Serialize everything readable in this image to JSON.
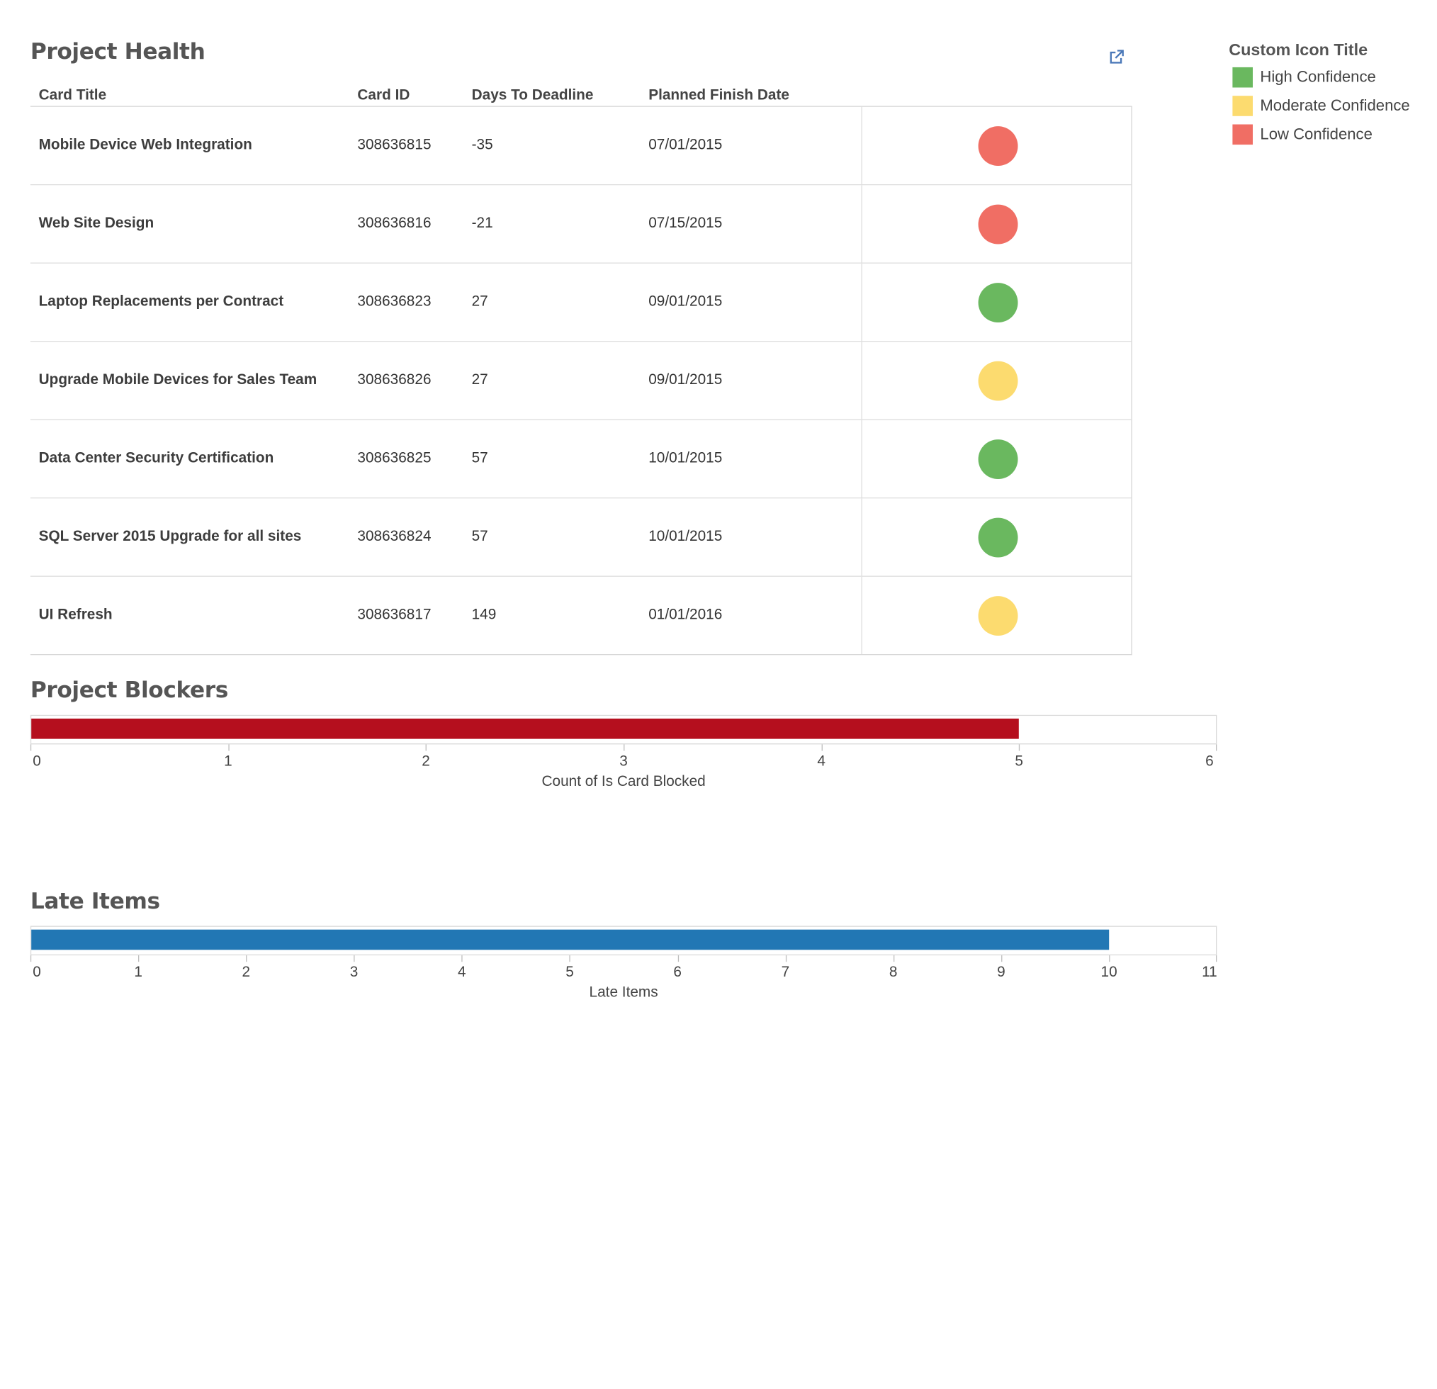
{
  "project_health": {
    "title": "Project Health",
    "columns": [
      "Card Title",
      "Card ID",
      "Days To Deadline",
      "Planned Finish Date"
    ],
    "rows": [
      {
        "title": "Mobile Device Web Integration",
        "card_id": "308636815",
        "days": "-35",
        "date": "07/01/2015",
        "confidence": "low"
      },
      {
        "title": "Web Site Design",
        "card_id": "308636816",
        "days": "-21",
        "date": "07/15/2015",
        "confidence": "low"
      },
      {
        "title": "Laptop Replacements per Contract",
        "card_id": "308636823",
        "days": "27",
        "date": "09/01/2015",
        "confidence": "high"
      },
      {
        "title": "Upgrade Mobile Devices for Sales Team",
        "card_id": "308636826",
        "days": "27",
        "date": "09/01/2015",
        "confidence": "moderate"
      },
      {
        "title": "Data Center Security Certification",
        "card_id": "308636825",
        "days": "57",
        "date": "10/01/2015",
        "confidence": "high"
      },
      {
        "title": "SQL Server 2015 Upgrade for all sites",
        "card_id": "308636824",
        "days": "57",
        "date": "10/01/2015",
        "confidence": "high"
      },
      {
        "title": "UI Refresh",
        "card_id": "308636817",
        "days": "149",
        "date": "01/01/2016",
        "confidence": "moderate"
      }
    ],
    "external_link_icon": "external-link-icon"
  },
  "legend": {
    "title": "Custom Icon Title",
    "items": [
      {
        "key": "high",
        "label": "High Confidence",
        "color": "#6ab85f"
      },
      {
        "key": "moderate",
        "label": "Moderate Confidence",
        "color": "#fcdb6f"
      },
      {
        "key": "low",
        "label": "Low Confidence",
        "color": "#f06e64"
      }
    ]
  },
  "project_blockers": {
    "title": "Project Blockers"
  },
  "late_items": {
    "title": "Late Items"
  },
  "chart_data": [
    {
      "type": "bar",
      "orientation": "horizontal",
      "title": "Project Blockers",
      "values": [
        5
      ],
      "xlabel": "Count of Is Card Blocked",
      "xlim": [
        0,
        6
      ],
      "ticks": [
        0,
        1,
        2,
        3,
        4,
        5,
        6
      ],
      "color": "#b50f1e"
    },
    {
      "type": "bar",
      "orientation": "horizontal",
      "title": "Late Items",
      "values": [
        10
      ],
      "xlabel": "Late Items",
      "xlim": [
        0,
        11
      ],
      "ticks": [
        0,
        1,
        2,
        3,
        4,
        5,
        6,
        7,
        8,
        9,
        10,
        11
      ],
      "color": "#2277b4"
    }
  ]
}
